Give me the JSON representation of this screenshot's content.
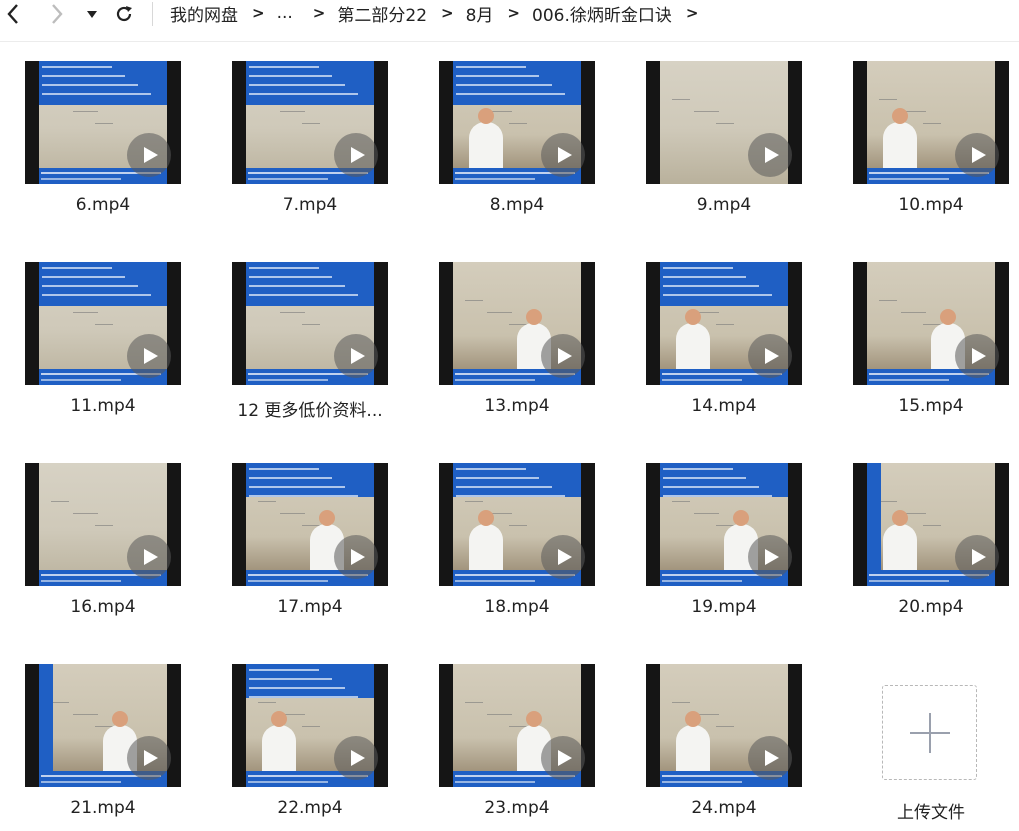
{
  "nav": {
    "back_icon": "chevron-left-icon",
    "forward_icon": "chevron-right-icon",
    "dropdown_icon": "caret-down-icon",
    "refresh_icon": "refresh-icon"
  },
  "breadcrumb": [
    "我的网盘",
    "...",
    "第二部分22",
    "8月",
    "006.徐炳昕金口诀"
  ],
  "breadcrumb_separator": ">",
  "files": [
    {
      "name": "6.mp4"
    },
    {
      "name": "7.mp4"
    },
    {
      "name": "8.mp4"
    },
    {
      "name": "9.mp4"
    },
    {
      "name": "10.mp4"
    },
    {
      "name": "11.mp4"
    },
    {
      "name": "12 更多低价资料..."
    },
    {
      "name": "13.mp4"
    },
    {
      "name": "14.mp4"
    },
    {
      "name": "15.mp4"
    },
    {
      "name": "16.mp4"
    },
    {
      "name": "17.mp4"
    },
    {
      "name": "18.mp4"
    },
    {
      "name": "19.mp4"
    },
    {
      "name": "20.mp4"
    },
    {
      "name": "21.mp4"
    },
    {
      "name": "22.mp4"
    },
    {
      "name": "23.mp4"
    },
    {
      "name": "24.mp4"
    }
  ],
  "upload": {
    "label": "上传文件",
    "icon": "plus-icon"
  },
  "colors": {
    "banner_blue": "#1f5fc4",
    "play_overlay": "#5a5a5a"
  }
}
